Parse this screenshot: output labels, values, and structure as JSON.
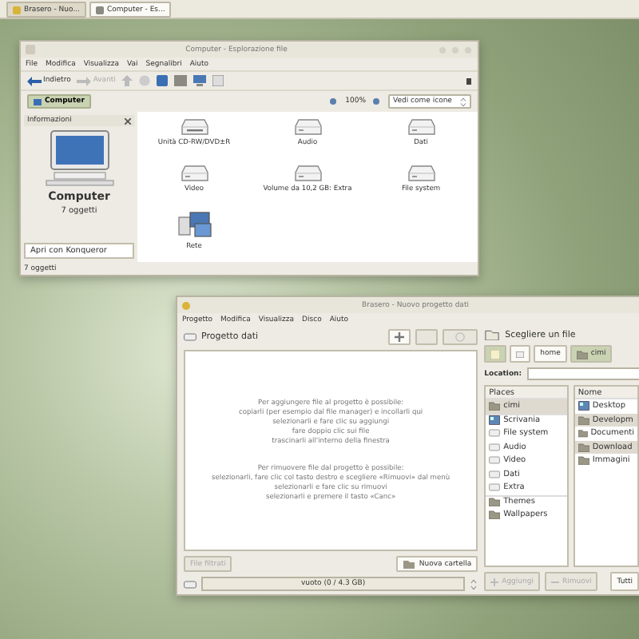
{
  "taskbar": [
    {
      "label": "Brasero - Nuo...",
      "selected": false
    },
    {
      "label": "Computer - Es...",
      "selected": true
    }
  ],
  "file_manager": {
    "title": "Computer - Esplorazione file",
    "menu": [
      "File",
      "Modifica",
      "Visualizza",
      "Vai",
      "Segnalibri",
      "Aiuto"
    ],
    "back": "Indietro",
    "forward": "Avanti",
    "location_button": "Computer",
    "zoom": "100%",
    "view_mode": "Vedi come icone",
    "sidebar": {
      "title": "Informazioni",
      "name": "Computer",
      "count": "7 oggetti",
      "open_with": "Apri con Konqueror"
    },
    "items": [
      {
        "label": "Unità CD-RW/DVD±R",
        "kind": "optical"
      },
      {
        "label": "Audio",
        "kind": "drive"
      },
      {
        "label": "Dati",
        "kind": "drive"
      },
      {
        "label": "Video",
        "kind": "drive"
      },
      {
        "label": "Volume da 10,2 GB: Extra",
        "kind": "drive"
      },
      {
        "label": "File system",
        "kind": "drive"
      },
      {
        "label": "Rete",
        "kind": "network"
      }
    ],
    "status": "7 oggetti"
  },
  "brasero": {
    "title": "Brasero - Nuovo progetto dati",
    "menu": [
      "Progetto",
      "Modifica",
      "Visualizza",
      "Disco",
      "Aiuto"
    ],
    "project_title": "Progetto dati",
    "add_help": [
      "Per aggiungere file al progetto è possibile:",
      "copiarli (per esempio dal file manager) e incollarli qui",
      "selezionarli e fare clic su aggiungi",
      "fare doppio clic sui file",
      "trascinarli all'interno della finestra"
    ],
    "remove_help": [
      "Per rimuovere file dal progetto è possibile:",
      "selezionarli, fare clic col tasto destro e scegliere «Rimuovi» dal menù",
      "selezionarli e fare clic su rimuovi",
      "selezionarli e premere il tasto «Canc»"
    ],
    "filtered_button": "File filtrati",
    "new_folder_button": "Nuova cartella",
    "disc_size": "vuoto (0 / 4.3 GB)",
    "chooser": {
      "title": "Scegliere un file",
      "path": [
        {
          "label": "home",
          "selected": false
        },
        {
          "label": "cimi",
          "selected": true
        }
      ],
      "location_label": "Location:",
      "places_header": "Places",
      "places": [
        {
          "label": "cimi",
          "kind": "folder"
        },
        {
          "label": "Scrivania",
          "kind": "desktop"
        },
        {
          "label": "File system",
          "kind": "drive"
        },
        {
          "label": "Audio",
          "kind": "drive"
        },
        {
          "label": "Video",
          "kind": "drive"
        },
        {
          "label": "Dati",
          "kind": "drive"
        },
        {
          "label": "Extra",
          "kind": "drive"
        },
        {
          "label": "Themes",
          "kind": "folder"
        },
        {
          "label": "Wallpapers",
          "kind": "folder"
        }
      ],
      "name_header": "Nome",
      "files": [
        {
          "label": "Desktop",
          "kind": "desktop",
          "selected": false
        },
        {
          "label": "Developm",
          "kind": "folder",
          "selected": true
        },
        {
          "label": "Documenti",
          "kind": "folder",
          "selected": false
        },
        {
          "label": "Download",
          "kind": "folder",
          "selected": true
        },
        {
          "label": "Immagini",
          "kind": "folder",
          "selected": false
        }
      ],
      "add_button": "Aggiungi",
      "remove_button": "Rimuovi",
      "filter": "Tutti"
    }
  }
}
